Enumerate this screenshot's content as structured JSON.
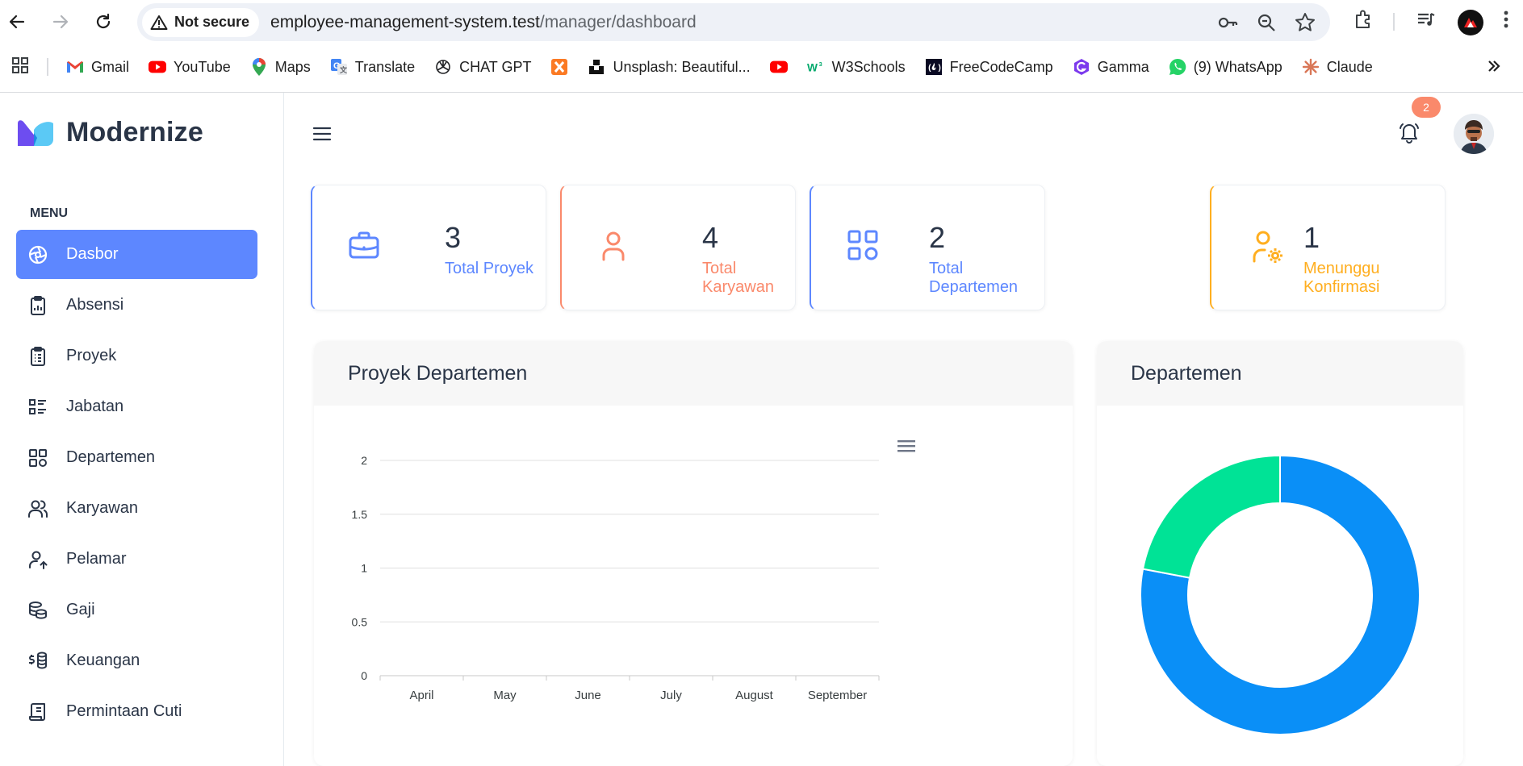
{
  "browser": {
    "security_label": "Not secure",
    "url_host": "employee-management-system.test",
    "url_path": "/manager/dashboard",
    "bookmarks": [
      {
        "label": "Gmail",
        "icon": "gmail-icon"
      },
      {
        "label": "YouTube",
        "icon": "youtube-icon"
      },
      {
        "label": "Maps",
        "icon": "maps-icon"
      },
      {
        "label": "Translate",
        "icon": "translate-icon"
      },
      {
        "label": "CHAT GPT",
        "icon": "chatgpt-icon"
      },
      {
        "label": "",
        "icon": "xampp-icon"
      },
      {
        "label": "Unsplash: Beautiful...",
        "icon": "unsplash-icon"
      },
      {
        "label": "",
        "icon": "youtube-icon"
      },
      {
        "label": "W3Schools",
        "icon": "w3schools-icon"
      },
      {
        "label": "FreeCodeCamp",
        "icon": "freecodecamp-icon"
      },
      {
        "label": "Gamma",
        "icon": "gamma-icon"
      },
      {
        "label": "(9) WhatsApp",
        "icon": "whatsapp-icon"
      },
      {
        "label": "Claude",
        "icon": "claude-icon"
      }
    ]
  },
  "app": {
    "brand": "Modernize",
    "menu_title": "MENU",
    "nav": [
      {
        "label": "Dasbor",
        "icon": "dashboard-icon",
        "active": true
      },
      {
        "label": "Absensi",
        "icon": "clipboard-chart-icon"
      },
      {
        "label": "Proyek",
        "icon": "clipboard-list-icon"
      },
      {
        "label": "Jabatan",
        "icon": "list-details-icon"
      },
      {
        "label": "Departemen",
        "icon": "category-icon"
      },
      {
        "label": "Karyawan",
        "icon": "users-icon"
      },
      {
        "label": "Pelamar",
        "icon": "user-up-icon"
      },
      {
        "label": "Gaji",
        "icon": "coins-icon"
      },
      {
        "label": "Keuangan",
        "icon": "dollar-stack-icon"
      },
      {
        "label": "Permintaan Cuti",
        "icon": "receipt-icon"
      }
    ],
    "notification_count": "2"
  },
  "stats": [
    {
      "value": "3",
      "label": "Total Proyek",
      "color": "#5d87ff",
      "icon": "briefcase-icon"
    },
    {
      "value": "4",
      "label": "Total Karyawan",
      "color": "#fa896b",
      "icon": "user-icon"
    },
    {
      "value": "2",
      "label": "Total Departemen",
      "color": "#5d87ff",
      "icon": "category-icon"
    },
    {
      "value": "1",
      "label": "Menunggu Konfirmasi",
      "color": "#ffae1f",
      "icon": "user-cog-icon"
    }
  ],
  "cards": {
    "bar_title": "Proyek Departemen",
    "donut_title": "Departemen"
  },
  "chart_data": [
    {
      "type": "bar",
      "title": "Proyek Departemen",
      "categories": [
        "April",
        "May",
        "June",
        "July",
        "August",
        "September"
      ],
      "series": [
        {
          "values": [
            0,
            0,
            0,
            0,
            0,
            0
          ]
        }
      ],
      "ylim": [
        0,
        2
      ],
      "yticks": [
        "0",
        "0.5",
        "1",
        "1.5",
        "2"
      ],
      "grid": true
    },
    {
      "type": "pie",
      "title": "Departemen",
      "donut": true,
      "values": [
        78,
        22
      ],
      "colors": [
        "#0a8ff7",
        "#00e396"
      ]
    }
  ]
}
